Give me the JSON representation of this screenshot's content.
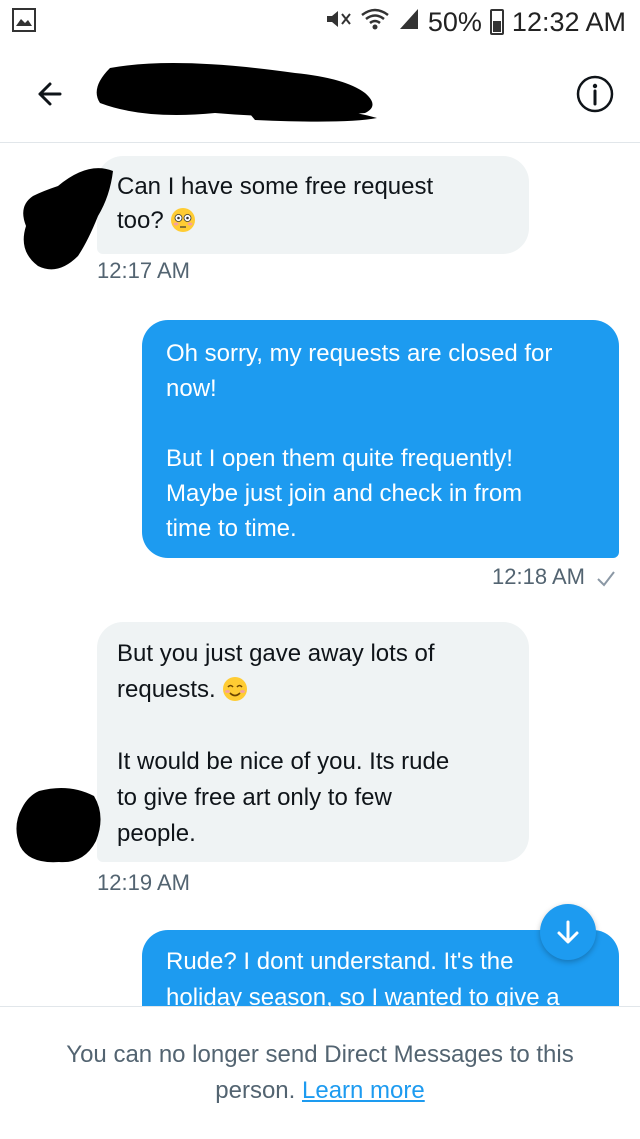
{
  "status_bar": {
    "battery": "50%",
    "time": "12:32 AM"
  },
  "header": {
    "back_icon": "arrow-left-icon",
    "info_icon": "info-circle-icon"
  },
  "messages": [
    {
      "side": "in",
      "lines": [
        "Can I have some free request",
        "too?"
      ],
      "emoji": "flushed-face",
      "time": "12:17 AM"
    },
    {
      "side": "out",
      "lines": [
        "Oh sorry, my requests are closed for",
        "now!",
        "",
        "But I open them quite frequently!",
        "Maybe just join and check in from",
        "time to time."
      ],
      "time": "12:18 AM",
      "status_icon": "check-icon"
    },
    {
      "side": "in",
      "lines": [
        "But you just gave away lots of",
        "requests.",
        "",
        "It would be nice of you. Its rude",
        "to give free art only to few",
        "people."
      ],
      "emoji": "smiling-face",
      "time": "12:19 AM"
    },
    {
      "side": "out",
      "lines": [
        "Rude? I dont understand. It's the",
        "holiday season, so I wanted to give a"
      ]
    }
  ],
  "footer": {
    "text": "You can no longer send Direct Messages to this person.",
    "link": "Learn more"
  },
  "colors": {
    "accent": "#1d9bf0",
    "incoming_bubble": "#eff3f4",
    "muted_text": "#536471"
  }
}
